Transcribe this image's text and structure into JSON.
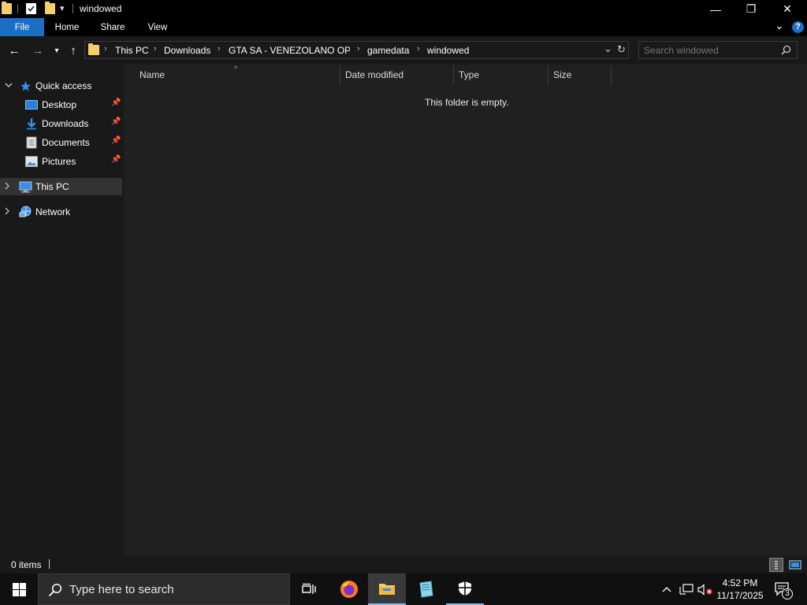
{
  "window": {
    "title": "windowed",
    "qat_dropdown": "▾",
    "minimize": "—",
    "restore": "❐",
    "close": "✕"
  },
  "ribbon": {
    "tabs": [
      "File",
      "Home",
      "Share",
      "View"
    ],
    "collapse_glyph": "⌄",
    "help_glyph": "?"
  },
  "nav": {
    "back": "←",
    "forward": "→",
    "recent": "▾",
    "up": "↑"
  },
  "address": {
    "crumbs": [
      "This PC",
      "Downloads",
      "GTA SA - VENEZOLANO OPTI",
      "gamedata",
      "windowed"
    ],
    "separator": "›",
    "dropdown": "⌄",
    "refresh": "↻"
  },
  "search": {
    "placeholder": "Search windowed"
  },
  "sidebar": {
    "quick_access": "Quick access",
    "pinned": [
      "Desktop",
      "Downloads",
      "Documents",
      "Pictures"
    ],
    "this_pc": "This PC",
    "network": "Network"
  },
  "columns": [
    "Name",
    "Date modified",
    "Type",
    "Size"
  ],
  "content": {
    "empty_message": "This folder is empty."
  },
  "status": {
    "item_count": "0 items"
  },
  "taskbar": {
    "search_placeholder": "Type here to search",
    "time": "4:52 PM",
    "date": "11/17/2025",
    "notification_count": "3"
  },
  "colors": {
    "accent": "#1a6fc4",
    "folder": "#f6cf6a",
    "pane_bg": "#191919",
    "content_bg": "#202020",
    "taskbar_bg": "#101010"
  }
}
